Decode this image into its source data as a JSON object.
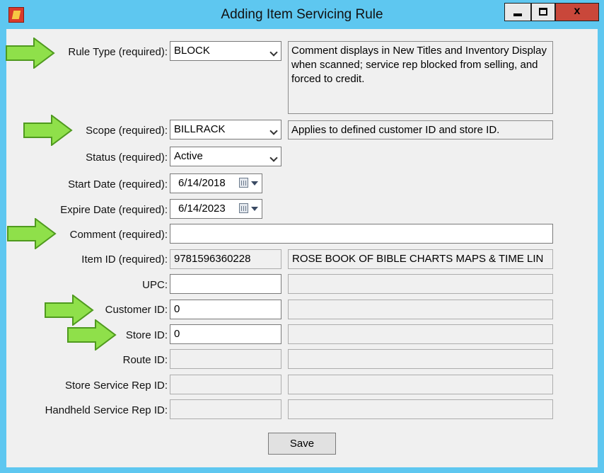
{
  "window": {
    "title": "Adding Item Servicing Rule",
    "minimize_icon": "minimize-icon",
    "maximize_icon": "maximize-icon",
    "close_label": "x"
  },
  "form": {
    "rule_type": {
      "label": "Rule Type (required):",
      "value": "BLOCK",
      "description": "Comment displays in New Titles and Inventory Display when scanned; service rep blocked from selling, and forced to credit."
    },
    "scope": {
      "label": "Scope (required):",
      "value": "BILLRACK",
      "description": "Applies to defined customer ID and store ID."
    },
    "status": {
      "label": "Status (required):",
      "value": "Active"
    },
    "start_date": {
      "label": "Start Date (required):",
      "value": "6/14/2018"
    },
    "expire_date": {
      "label": "Expire Date (required):",
      "value": "6/14/2023"
    },
    "comment": {
      "label": "Comment (required):",
      "value": ""
    },
    "item_id": {
      "label": "Item ID (required):",
      "value": "9781596360228",
      "description": "ROSE BOOK OF BIBLE CHARTS MAPS & TIME LIN"
    },
    "upc": {
      "label": "UPC:",
      "value": "",
      "description": ""
    },
    "customer_id": {
      "label": "Customer ID:",
      "value": "0",
      "description": ""
    },
    "store_id": {
      "label": "Store ID:",
      "value": "0",
      "description": ""
    },
    "route_id": {
      "label": "Route ID:",
      "value": "",
      "description": ""
    },
    "store_service_rep_id": {
      "label": "Store Service Rep ID:",
      "value": "",
      "description": ""
    },
    "handheld_service_rep_id": {
      "label": "Handheld Service Rep ID:",
      "value": "",
      "description": ""
    },
    "save_label": "Save"
  },
  "annotation_color": "#8fe04a"
}
